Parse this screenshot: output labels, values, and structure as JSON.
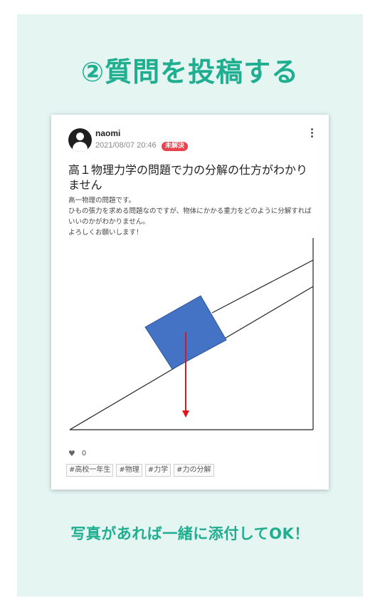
{
  "headline": "②質問を投稿する",
  "post": {
    "username": "naomi",
    "timestamp": "2021/08/07 20:46",
    "status_badge": "未解決",
    "title": "高１物理力学の問題で力の分解の仕方がわかりません",
    "body_lines": [
      "高一物理の問題です。",
      "ひもの張力を求める問題なのですが、物体にかかる重力をどのように分解すればいいのかがわかりません。",
      "よろしくお願いします！"
    ],
    "likes": "0",
    "tags": [
      "#高校一年生",
      "#物理",
      "#力学",
      "#力の分解"
    ]
  },
  "figure": {
    "block_color": "#4472c4",
    "arrow_color": "#e0141e"
  },
  "caption": "写真があれば一緒に添付してOK！",
  "colors": {
    "accent": "#1fae8f",
    "panel_bg": "#e4f5f2",
    "badge": "#e8424d"
  }
}
